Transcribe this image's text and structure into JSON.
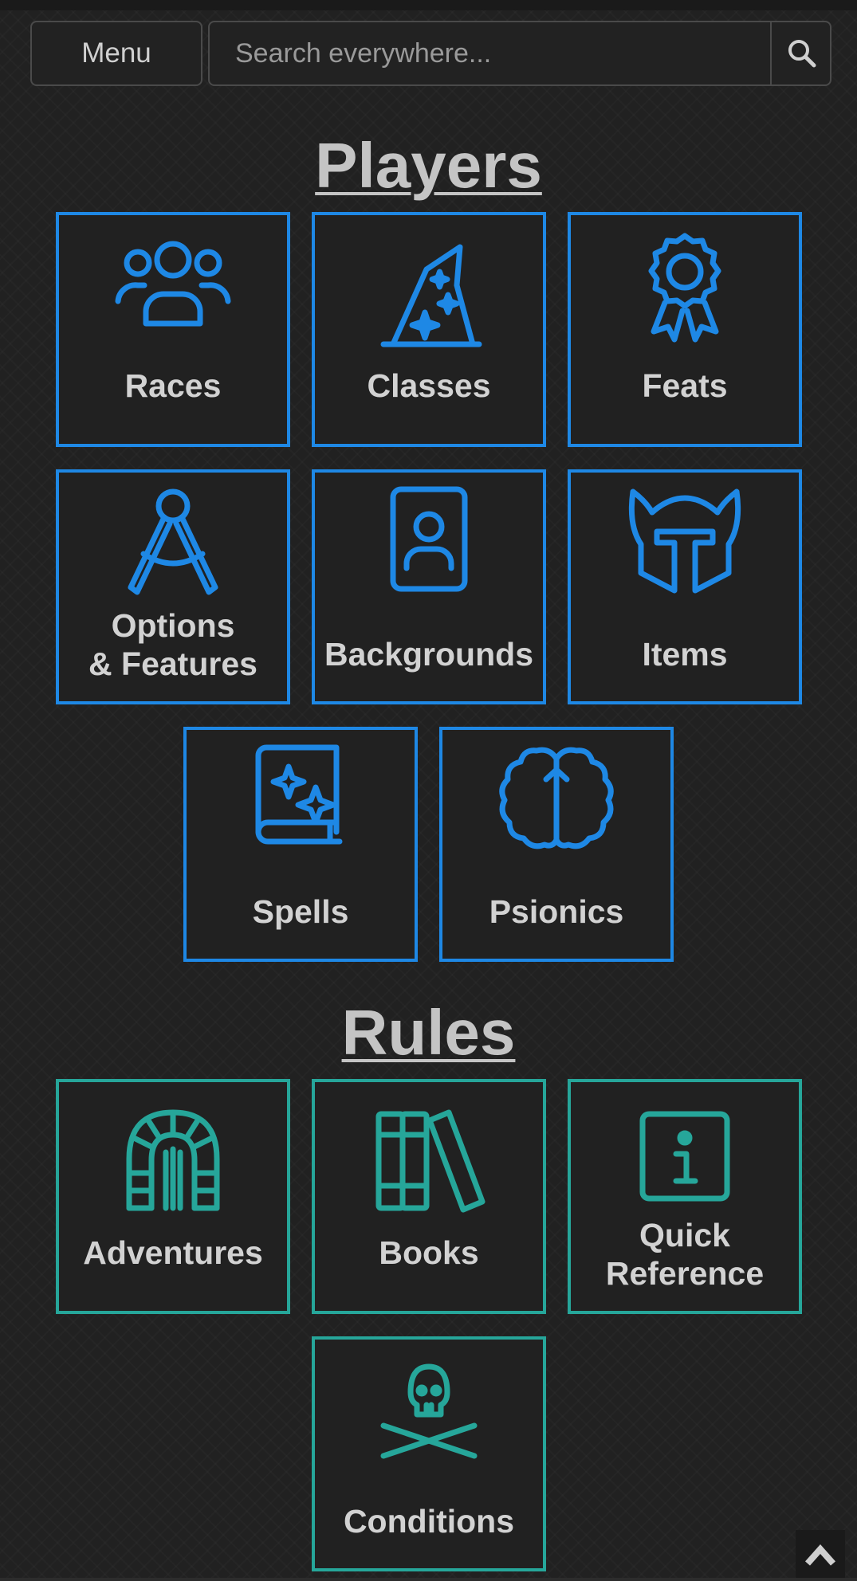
{
  "header": {
    "menu_label": "Menu",
    "search_placeholder": "Search everywhere..."
  },
  "sections": {
    "players": {
      "title": "Players",
      "tiles": [
        {
          "label": "Races",
          "icon": "people-group-icon"
        },
        {
          "label": "Classes",
          "icon": "wizard-hat-icon"
        },
        {
          "label": "Feats",
          "icon": "award-ribbon-icon"
        },
        {
          "label_line1": "Options",
          "label_line2": "& Features",
          "icon": "drafting-compass-icon"
        },
        {
          "label": "Backgrounds",
          "icon": "id-card-icon"
        },
        {
          "label": "Items",
          "icon": "helmet-icon"
        },
        {
          "label": "Spells",
          "icon": "spellbook-icon"
        },
        {
          "label": "Psionics",
          "icon": "brain-icon"
        }
      ]
    },
    "rules": {
      "title": "Rules",
      "tiles": [
        {
          "label": "Adventures",
          "icon": "dungeon-gate-icon"
        },
        {
          "label": "Books",
          "icon": "books-icon"
        },
        {
          "label_line1": "Quick",
          "label_line2": "Reference",
          "icon": "info-square-icon"
        },
        {
          "label": "Conditions",
          "icon": "skull-crossbones-icon"
        }
      ]
    }
  },
  "colors": {
    "background": "#212121",
    "players_accent": "#1e88e5",
    "rules_accent": "#26a69a",
    "text": "#d2d2d2"
  }
}
